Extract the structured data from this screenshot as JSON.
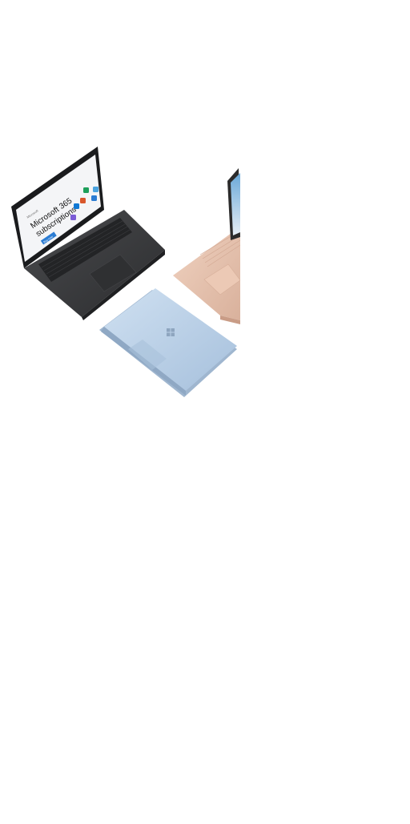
{
  "hero_image": {
    "screen": {
      "brand": "Microsoft",
      "headline_line1": "Microsoft 365",
      "headline_line2": "subscriptions",
      "cta_label": "Buy now"
    },
    "device_colors": {
      "black_laptop": "#3a3b3d",
      "sandstone_laptop": "#e8c7b3",
      "ice_blue_laptop": "#b8cfe6",
      "screen_bg": "#f4f5f7",
      "accent_blue": "#2b7cd3"
    },
    "icons": [
      "outlook-icon",
      "excel-icon",
      "word-icon",
      "powerpoint-icon",
      "onedrive-icon",
      "teams-icon"
    ]
  }
}
